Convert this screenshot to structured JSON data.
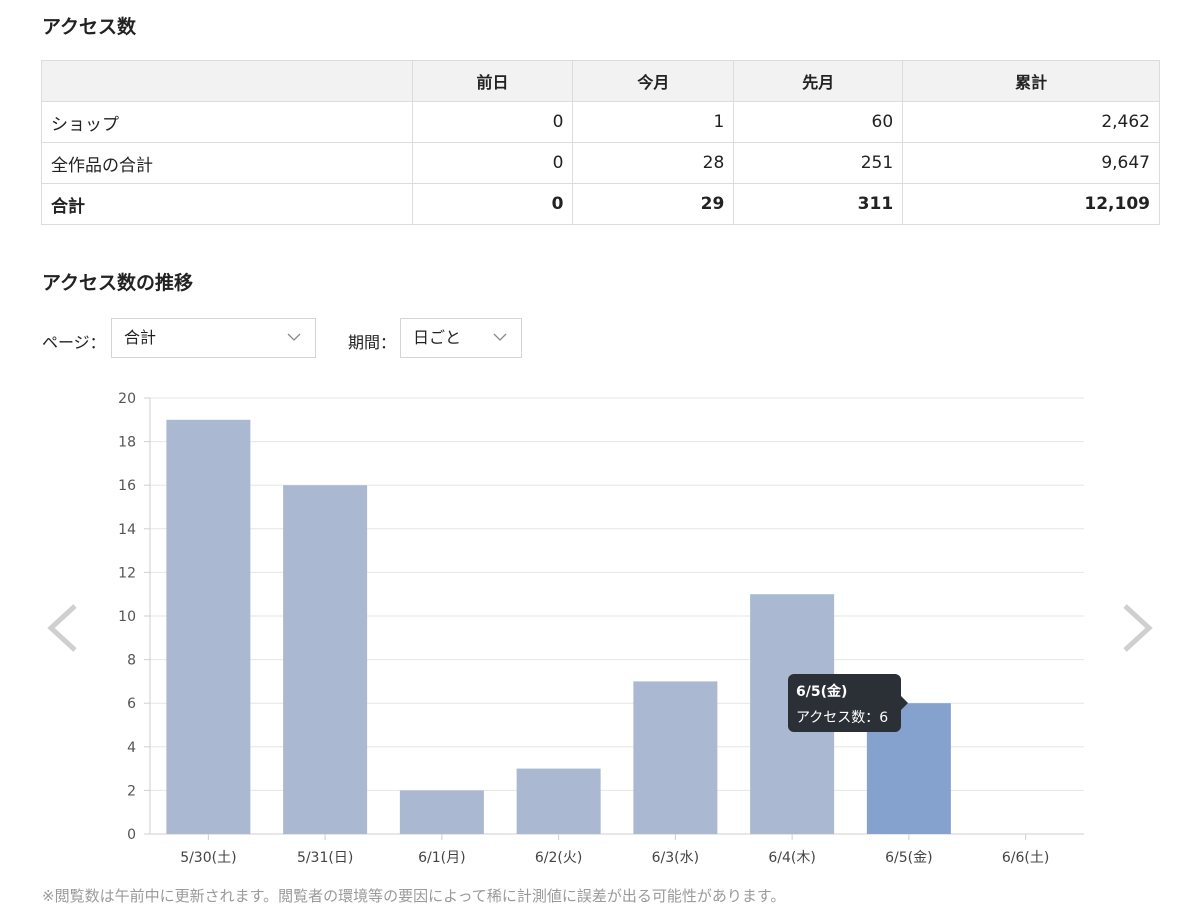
{
  "section_access": {
    "title": "アクセス数"
  },
  "stats_table": {
    "headers": [
      "",
      "前日",
      "今月",
      "先月",
      "累計"
    ],
    "rows": [
      {
        "label": "ショップ",
        "cells": [
          "0",
          "1",
          "60",
          "2,462"
        ]
      },
      {
        "label": "全作品の合計",
        "cells": [
          "0",
          "28",
          "251",
          "9,647"
        ]
      },
      {
        "label": "合計",
        "cells": [
          "0",
          "29",
          "311",
          "12,109"
        ]
      }
    ]
  },
  "section_trend": {
    "title": "アクセス数の推移"
  },
  "filters": {
    "page_label": "ページ：",
    "page_value": "合計",
    "period_label": "期間：",
    "period_value": "日ごと"
  },
  "chart_data": {
    "type": "bar",
    "categories": [
      "5/30(土)",
      "5/31(日)",
      "6/1(月)",
      "6/2(火)",
      "6/3(水)",
      "6/4(木)",
      "6/5(金)",
      "6/6(土)"
    ],
    "values": [
      19,
      16,
      2,
      3,
      7,
      11,
      6,
      0
    ],
    "ylim": [
      0,
      20
    ],
    "yticks": [
      0,
      2,
      4,
      6,
      8,
      10,
      12,
      14,
      16,
      18,
      20
    ],
    "grid": true,
    "highlight_index": 6,
    "bar_color": "#aab9d1",
    "highlight_color": "#85a2cf"
  },
  "tooltip": {
    "title": "6/5(金)",
    "text": "アクセス数：6"
  },
  "footnote": "※閲覧数は午前中に更新されます。閲覧者の環境等の要因によって稀に計測値に誤差が出る可能性があります。"
}
